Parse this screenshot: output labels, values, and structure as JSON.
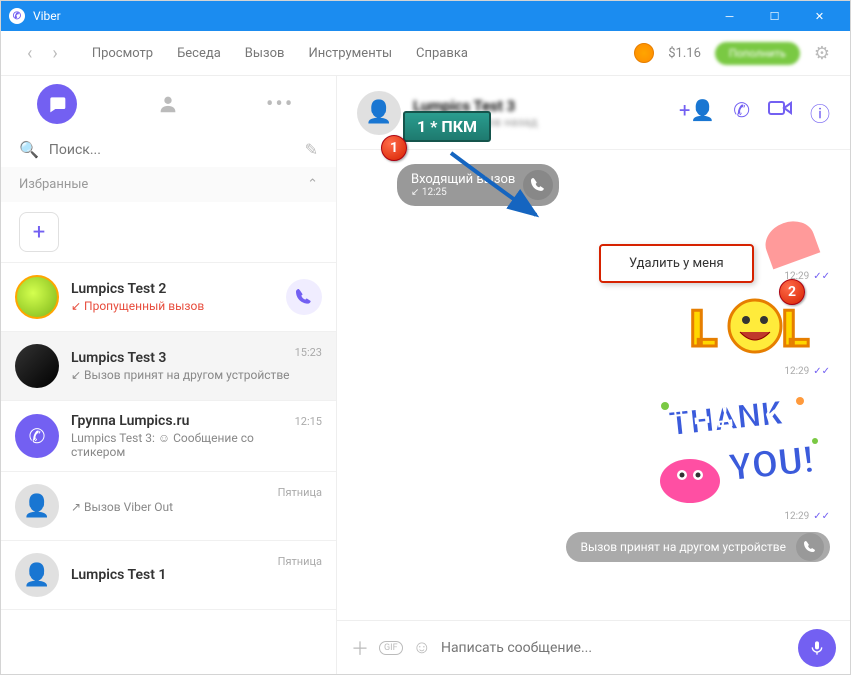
{
  "titlebar": {
    "app": "Viber"
  },
  "menu": [
    "Просмотр",
    "Беседа",
    "Вызов",
    "Инструменты",
    "Справка"
  ],
  "balance": "$1.16",
  "topup_label": "Пополнить",
  "search": {
    "placeholder": "Поиск..."
  },
  "section_favorites": "Избранные",
  "chats": [
    {
      "name": "Lumpics Test 2",
      "sub": "↙ Пропущенный вызов",
      "missed": true,
      "time": "",
      "call": true
    },
    {
      "name": "Lumpics Test 3",
      "sub": "↙ Вызов принят на другом устройстве",
      "time": "15:23",
      "selected": true
    },
    {
      "name": "Группа Lumpics.ru",
      "sub": "Lumpics Test 3: ☺ Сообщение со стикером",
      "time": "12:15"
    },
    {
      "name": " ",
      "sub": "↗ Вызов Viber Out",
      "time": "Пятница",
      "blur": true
    },
    {
      "name": "Lumpics Test 1",
      "sub": "",
      "time": "Пятница"
    }
  ],
  "chat_header": {
    "name": "Lumpics Test 3",
    "status": "В сети 12 часов назад"
  },
  "incoming_call": {
    "label": "Входящий вызов",
    "time": "12:25"
  },
  "stickers": {
    "t1": "12:29",
    "t2": "12:29",
    "t3": "12:29"
  },
  "answered_other": "Вызов принят на другом устройстве",
  "composer": {
    "placeholder": "Написать сообщение..."
  },
  "annotation": {
    "label": "1 * ПКМ",
    "context_item": "Удалить у меня"
  }
}
